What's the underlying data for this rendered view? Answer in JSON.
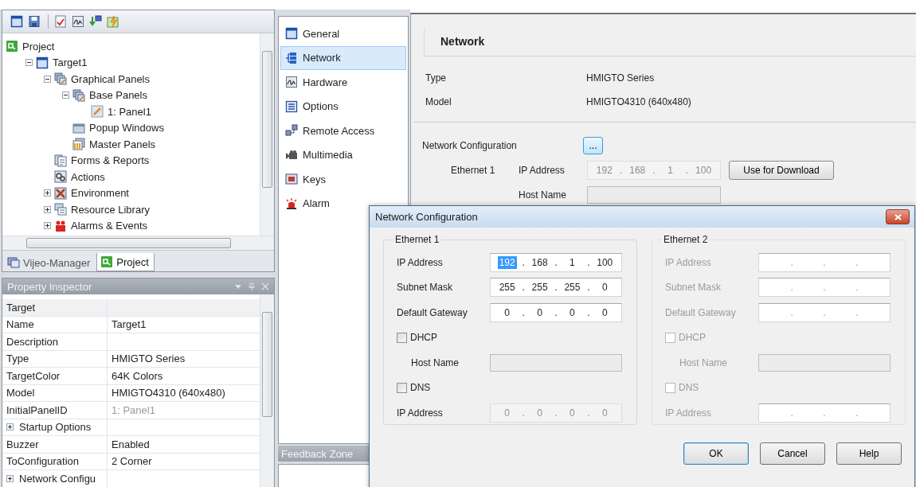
{
  "project_panel": {
    "tree": [
      {
        "label": "Project",
        "kind": "project",
        "children": [
          {
            "label": "Target1",
            "kind": "target",
            "expanded": true,
            "children": [
              {
                "label": "Graphical Panels",
                "kind": "panels",
                "expanded": true,
                "children": [
                  {
                    "label": "Base Panels",
                    "kind": "panels",
                    "expanded": true,
                    "children": [
                      {
                        "label": "1: Panel1",
                        "kind": "panel"
                      }
                    ]
                  },
                  {
                    "label": "Popup Windows",
                    "kind": "popup"
                  },
                  {
                    "label": "Master Panels",
                    "kind": "master"
                  }
                ]
              },
              {
                "label": "Forms & Reports",
                "kind": "forms"
              },
              {
                "label": "Actions",
                "kind": "actions"
              },
              {
                "label": "Environment",
                "kind": "environment",
                "expanded": false
              },
              {
                "label": "Resource Library",
                "kind": "resource",
                "expanded": false
              },
              {
                "label": "Alarms & Events",
                "kind": "alarms",
                "expanded": false
              }
            ]
          }
        ]
      }
    ],
    "tabs": [
      {
        "label": "Vijeo-Manager",
        "kind": "manager",
        "selected": false
      },
      {
        "label": "Project",
        "kind": "project",
        "selected": true
      }
    ]
  },
  "property_inspector": {
    "title": "Property Inspector",
    "rows": [
      {
        "kind": "category",
        "name": "Target"
      },
      {
        "kind": "property",
        "name": "Name",
        "value": "Target1",
        "disabled": false
      },
      {
        "kind": "property",
        "name": "Description"
      },
      {
        "kind": "property",
        "name": "Type",
        "value": "HMIGTO Series",
        "disabled": false
      },
      {
        "kind": "property",
        "name": "TargetColor",
        "value": "64K Colors",
        "disabled": false
      },
      {
        "kind": "property",
        "name": "Model",
        "value": "HMIGTO4310 (640x480)",
        "disabled": false
      },
      {
        "kind": "property",
        "name": "InitialPanelID",
        "value": "1: Panel1",
        "disabled": true
      },
      {
        "kind": "group",
        "name": "Startup Options",
        "expanded": false
      },
      {
        "kind": "property",
        "name": "Buzzer",
        "value": "Enabled",
        "disabled": false
      },
      {
        "kind": "property",
        "name": "ToConfiguration",
        "value": "2 Corner",
        "disabled": false
      },
      {
        "kind": "group",
        "name": "Network Configu",
        "expanded": false
      }
    ]
  },
  "navigation": {
    "items": [
      {
        "label": "General",
        "kind": "target",
        "selected": false
      },
      {
        "label": "Network",
        "kind": "network",
        "selected": true
      },
      {
        "label": "Hardware",
        "kind": "hardware",
        "selected": false
      },
      {
        "label": "Options",
        "kind": "options",
        "selected": false
      },
      {
        "label": "Remote Access",
        "kind": "remote",
        "selected": false
      },
      {
        "label": "Multimedia",
        "kind": "multimedia",
        "selected": false
      },
      {
        "label": "Keys",
        "kind": "keys",
        "selected": false
      },
      {
        "label": "Alarm",
        "kind": "alarm",
        "selected": false
      }
    ]
  },
  "feedback_zone": {
    "title": "Feedback Zone"
  },
  "network_page": {
    "title": "Network",
    "type_label": "Type",
    "type_value": "HMIGTO Series",
    "model_label": "Model",
    "model_value": "HMIGTO4310 (640x480)",
    "config_label": "Network Configuration",
    "config_button": "...",
    "ethernet_label": "Ethernet 1",
    "ip_label": "IP Address",
    "ip_field": {
      "separator": ".",
      "disabled": true,
      "segments": [
        {
          "text": "192",
          "selected": false
        },
        {
          "text": "168",
          "selected": false
        },
        {
          "text": "1",
          "selected": false
        },
        {
          "text": "100",
          "selected": false
        }
      ]
    },
    "download_button": "Use for Download",
    "host_label": "Host Name",
    "host_field": {
      "disabled": true
    }
  },
  "dialog": {
    "title": "Network Configuration",
    "groups": [
      {
        "title": "Ethernet 1",
        "disabled": false,
        "rows": [
          {
            "kind": "ip",
            "label": "IP Address",
            "field": {
              "separator": ".",
              "disabled": false,
              "segments": [
                {
                  "text": "192",
                  "selected": true
                },
                {
                  "text": "168",
                  "selected": false
                },
                {
                  "text": "1",
                  "selected": false
                },
                {
                  "text": "100",
                  "selected": false
                }
              ]
            }
          },
          {
            "kind": "ip",
            "label": "Subnet Mask",
            "field": {
              "separator": ".",
              "disabled": false,
              "segments": [
                {
                  "text": "255",
                  "selected": false
                },
                {
                  "text": "255",
                  "selected": false
                },
                {
                  "text": "255",
                  "selected": false
                },
                {
                  "text": "0",
                  "selected": false
                }
              ]
            }
          },
          {
            "kind": "ip",
            "label": "Default Gateway",
            "field": {
              "separator": ".",
              "disabled": false,
              "segments": [
                {
                  "text": "0",
                  "selected": false
                },
                {
                  "text": "0",
                  "selected": false
                },
                {
                  "text": "0",
                  "selected": false
                },
                {
                  "text": "0",
                  "selected": false
                }
              ]
            }
          },
          {
            "kind": "checkbox",
            "label": "DHCP",
            "checked": false
          },
          {
            "kind": "text",
            "label": "Host Name",
            "field": {
              "disabled": true
            }
          },
          {
            "kind": "checkbox",
            "label": "DNS",
            "checked": false
          },
          {
            "kind": "ip",
            "label": "IP Address",
            "field": {
              "separator": ".",
              "disabled": true,
              "segments": [
                {
                  "text": "0",
                  "selected": false
                },
                {
                  "text": "0",
                  "selected": false
                },
                {
                  "text": "0",
                  "selected": false
                },
                {
                  "text": "0",
                  "selected": false
                }
              ]
            }
          }
        ]
      },
      {
        "title": "Ethernet 2",
        "disabled": true,
        "rows": [
          {
            "kind": "ip",
            "label": "IP Address",
            "field": {
              "separator": ".",
              "disabled": false,
              "segments": [
                {
                  "selected": false
                },
                {
                  "selected": false
                },
                {
                  "selected": false
                },
                {
                  "selected": false
                }
              ]
            }
          },
          {
            "kind": "ip",
            "label": "Subnet Mask",
            "field": {
              "separator": ".",
              "disabled": false,
              "segments": [
                {
                  "selected": false
                },
                {
                  "selected": false
                },
                {
                  "selected": false
                },
                {
                  "selected": false
                }
              ]
            }
          },
          {
            "kind": "ip",
            "label": "Default Gateway",
            "field": {
              "separator": ".",
              "disabled": false,
              "segments": [
                {
                  "selected": false
                },
                {
                  "selected": false
                },
                {
                  "selected": false
                },
                {
                  "selected": false
                }
              ]
            }
          },
          {
            "kind": "checkbox",
            "label": "DHCP",
            "checked": false
          },
          {
            "kind": "text",
            "label": "Host Name",
            "field": {
              "disabled": true
            }
          },
          {
            "kind": "checkbox",
            "label": "DNS",
            "checked": false
          },
          {
            "kind": "ip",
            "label": "IP Address",
            "field": {
              "separator": ".",
              "disabled": false,
              "segments": [
                {
                  "selected": false
                },
                {
                  "selected": false
                },
                {
                  "selected": false
                },
                {
                  "selected": false
                }
              ]
            }
          }
        ]
      }
    ],
    "buttons": [
      {
        "label": "OK",
        "focused": true
      },
      {
        "label": "Cancel",
        "focused": false
      },
      {
        "label": "Help",
        "focused": false
      }
    ]
  }
}
